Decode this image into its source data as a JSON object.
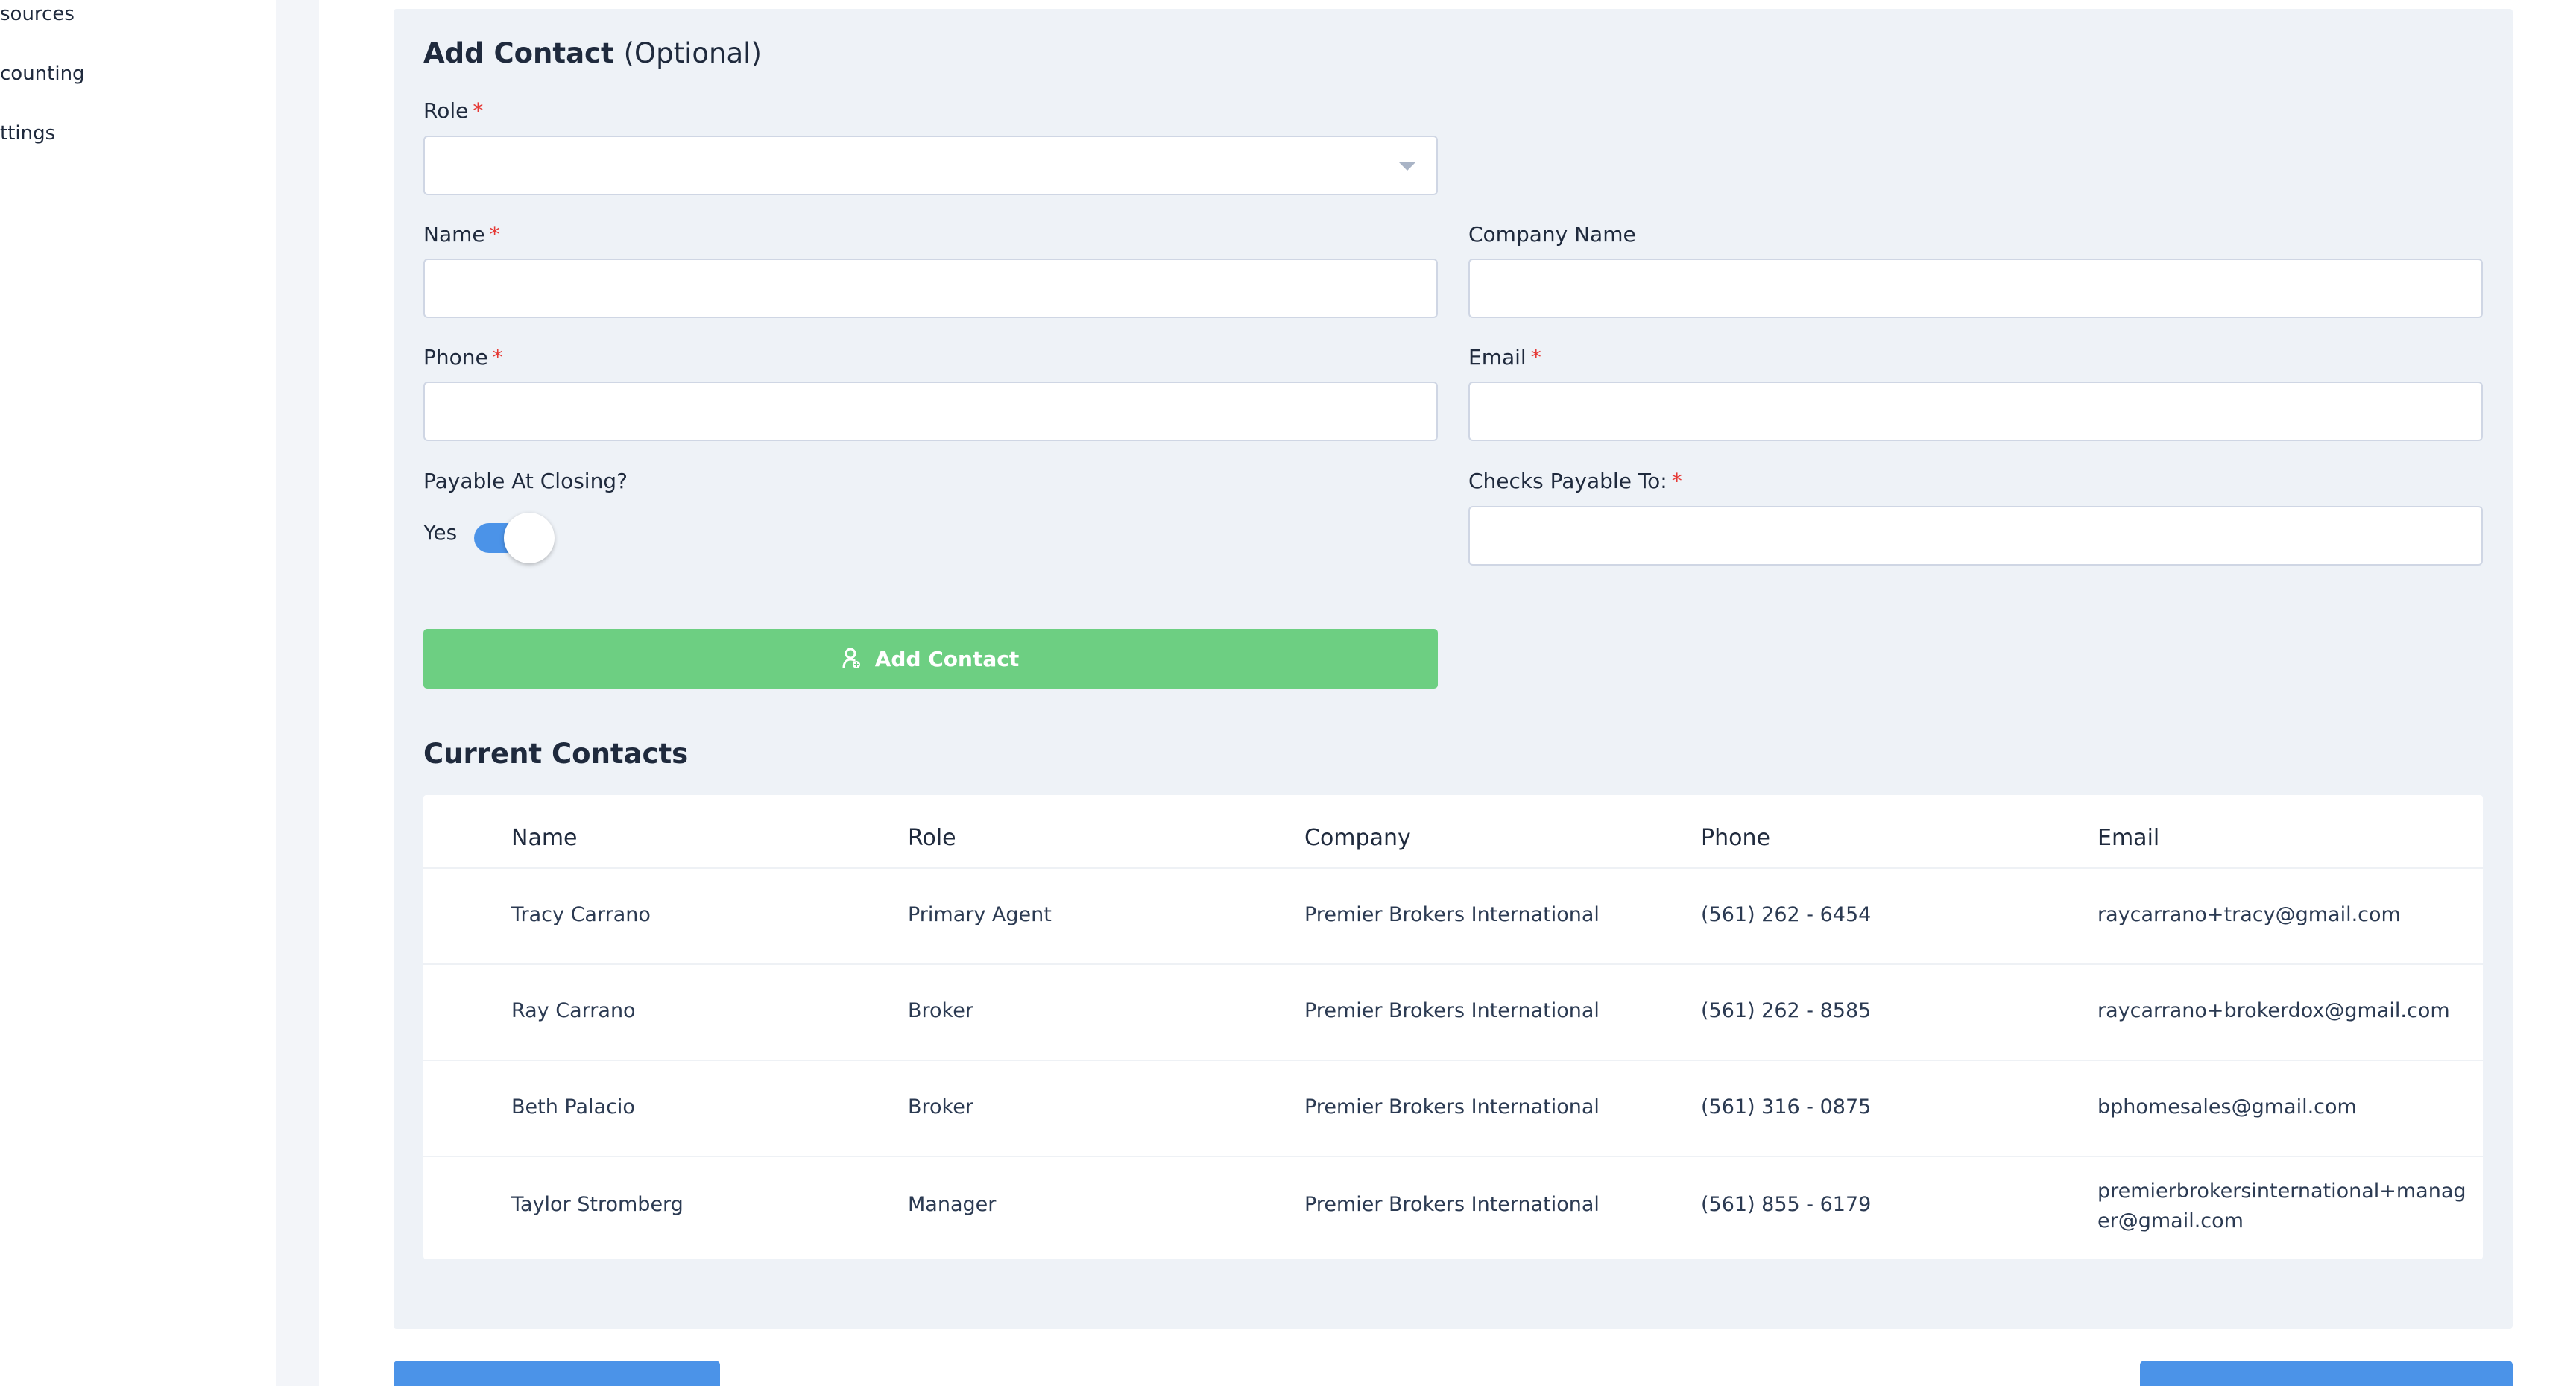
{
  "sidebar": {
    "items": [
      {
        "label": "sources"
      },
      {
        "label": "counting"
      },
      {
        "label": "ttings"
      }
    ]
  },
  "form": {
    "title": "Add Contact",
    "title_suffix": "(Optional)",
    "role_label": "Role",
    "role_value": "",
    "name_label": "Name",
    "company_label": "Company Name",
    "phone_label": "Phone",
    "email_label": "Email",
    "payable_label": "Payable At Closing?",
    "payable_toggle_text": "Yes",
    "payable_on": true,
    "checks_label": "Checks Payable To:",
    "required_mark": "*",
    "add_button": "Add Contact"
  },
  "contacts": {
    "title": "Current Contacts",
    "columns": [
      "Name",
      "Role",
      "Company",
      "Phone",
      "Email"
    ],
    "rows": [
      {
        "name": "Tracy Carrano",
        "role": "Primary Agent",
        "company": "Premier Brokers International",
        "phone": "(561) 262 - 6454",
        "email": "raycarrano+tracy@gmail.com"
      },
      {
        "name": "Ray Carrano",
        "role": "Broker",
        "company": "Premier Brokers International",
        "phone": "(561) 262 - 8585",
        "email": "raycarrano+brokerdox@gmail.com"
      },
      {
        "name": "Beth Palacio",
        "role": "Broker",
        "company": "Premier Brokers International",
        "phone": "(561) 316 - 0875",
        "email": "bphomesales@gmail.com"
      },
      {
        "name": "Taylor Stromberg",
        "role": "Manager",
        "company": "Premier Brokers International",
        "phone": "(561) 855 - 6179",
        "email": "premierbrokersinternational+manager@gmail.com"
      }
    ]
  },
  "colors": {
    "accent": "#4b93e8",
    "success": "#6dcf82",
    "required": "#e53935",
    "panel_bg": "#eef2f7"
  },
  "icons": {
    "add_contact": "user-plus-icon",
    "select": "chevron-down-icon"
  }
}
